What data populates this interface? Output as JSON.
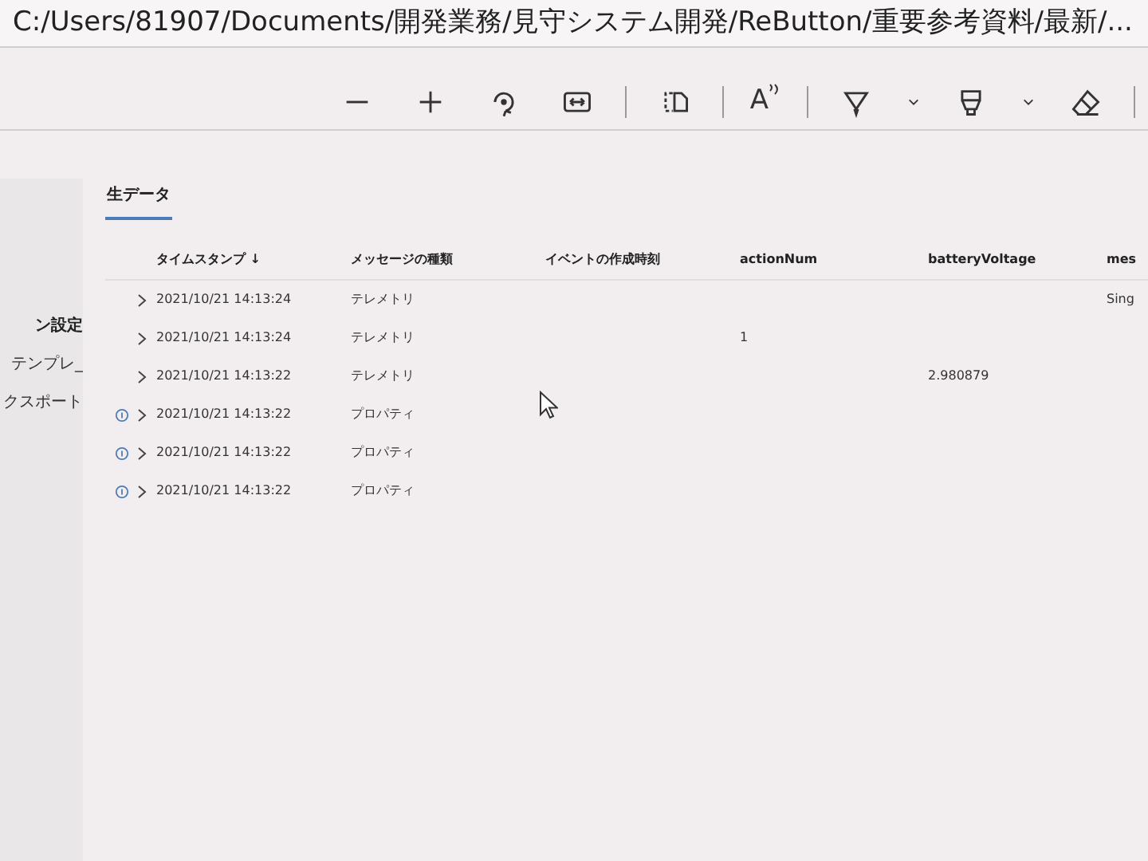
{
  "path_bar": {
    "path": "C:/Users/81907/Documents/開発業務/見守システム開発/ReButton/重要参考資料/最新/..."
  },
  "toolbar": [
    {
      "kind": "zoom-out"
    },
    {
      "kind": "zoom-in"
    },
    {
      "kind": "rotate"
    },
    {
      "kind": "fit-width"
    },
    {
      "kind": "separator"
    },
    {
      "kind": "page-view"
    },
    {
      "kind": "separator"
    },
    {
      "kind": "read-aloud",
      "label": "A"
    },
    {
      "kind": "separator"
    },
    {
      "kind": "draw"
    },
    {
      "kind": "chevron"
    },
    {
      "kind": "highlight"
    },
    {
      "kind": "chevron"
    },
    {
      "kind": "eraser"
    },
    {
      "kind": "separator"
    }
  ],
  "sidebar": {
    "items": [
      {
        "label": "ン設定",
        "bold": true
      },
      {
        "label": "テンプレ_",
        "bold": false
      },
      {
        "label": "クスポート",
        "bold": false
      }
    ]
  },
  "tabs": [
    {
      "label": "生データ",
      "selected": true
    }
  ],
  "table": {
    "columns": [
      {
        "label": "タイムスタンプ ↓"
      },
      {
        "label": "メッセージの種類"
      },
      {
        "label": "イベントの作成時刻"
      },
      {
        "label": "actionNum"
      },
      {
        "label": "batteryVoltage"
      },
      {
        "label": "mes"
      }
    ],
    "rows": [
      {
        "has_info": false,
        "timestamp": "2021/10/21 14:13:24",
        "message_type": "テレメトリ",
        "column_6": "Sing"
      },
      {
        "has_info": false,
        "timestamp": "2021/10/21 14:13:24",
        "message_type": "テレメトリ",
        "action_num": "1"
      },
      {
        "has_info": false,
        "timestamp": "2021/10/21 14:13:22",
        "message_type": "テレメトリ",
        "battery_voltage": "2.980879"
      },
      {
        "has_info": true,
        "timestamp": "2021/10/21 14:13:22",
        "message_type": "プロパティ"
      },
      {
        "has_info": true,
        "timestamp": "2021/10/21 14:13:22",
        "message_type": "プロパティ"
      },
      {
        "has_info": true,
        "timestamp": "2021/10/21 14:13:22",
        "message_type": "プロパティ"
      }
    ]
  }
}
